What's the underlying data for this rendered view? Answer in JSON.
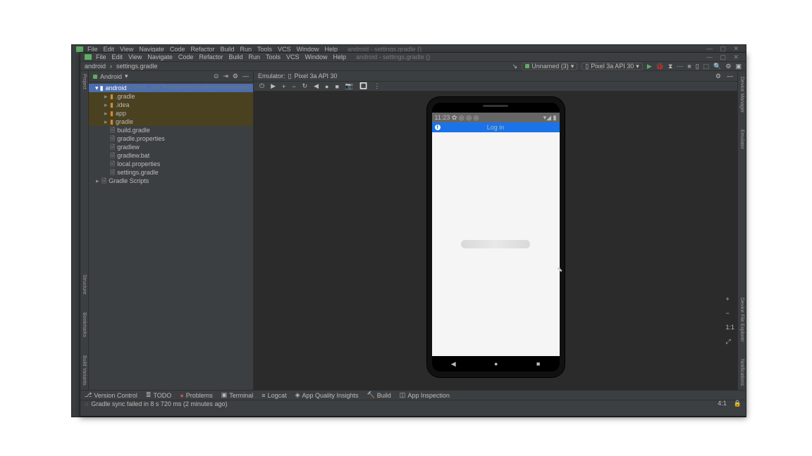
{
  "window_outer": {
    "title_hint": "android - settings.gradle ()",
    "menu": [
      "File",
      "Edit",
      "View",
      "Navigate",
      "Code",
      "Refactor",
      "Build",
      "Run",
      "Tools",
      "VCS",
      "Window",
      "Help"
    ]
  },
  "window_inner": {
    "menu": [
      "File",
      "Edit",
      "View",
      "Navigate",
      "Code",
      "Refactor",
      "Build",
      "Run",
      "Tools",
      "VCS",
      "Window",
      "Help"
    ],
    "tab_hint": "android - settings.gradle ()"
  },
  "breadcrumb": {
    "root": "android",
    "file": "settings.gradle"
  },
  "toolbar": {
    "run_config": "Unnamed (3)",
    "device": "Pixel 3a API 30"
  },
  "left_gutter": [
    "Project"
  ],
  "right_gutter_outer": [
    "Device Manager",
    "Emulator"
  ],
  "right_gutter_inner": [
    "Device File Explorer",
    "Notifications"
  ],
  "project_pane": {
    "header": "Android",
    "tree": [
      {
        "d": 0,
        "expand": "▾",
        "icon": "folder",
        "label": "android",
        "path": "C:\\Users\\...Day Tech\\appsinfoo\\sandbox\\android\\android",
        "sel": true
      },
      {
        "d": 1,
        "expand": "▸",
        "icon": "folder",
        "label": ".gradle",
        "hl": true
      },
      {
        "d": 1,
        "expand": "▸",
        "icon": "folder",
        "label": ".idea",
        "hl": true
      },
      {
        "d": 1,
        "expand": "▸",
        "icon": "folder",
        "label": "app",
        "hl": true
      },
      {
        "d": 1,
        "expand": "▸",
        "icon": "folder",
        "label": "gradle",
        "hl": true
      },
      {
        "d": 1,
        "expand": "",
        "icon": "file",
        "label": "build.gradle"
      },
      {
        "d": 1,
        "expand": "",
        "icon": "file",
        "label": "gradle.properties"
      },
      {
        "d": 1,
        "expand": "",
        "icon": "file",
        "label": "gradlew"
      },
      {
        "d": 1,
        "expand": "",
        "icon": "file",
        "label": "gradlew.bat"
      },
      {
        "d": 1,
        "expand": "",
        "icon": "file",
        "label": "local.properties"
      },
      {
        "d": 1,
        "expand": "",
        "icon": "file",
        "label": "settings.gradle"
      },
      {
        "d": 0,
        "expand": "▸",
        "icon": "file",
        "label": "Gradle Scripts"
      }
    ]
  },
  "editor_tabs": {
    "left": "Emulator:",
    "device": "Pixel 3a API 30"
  },
  "emu_toolbar_icons": [
    "⏻",
    "▶",
    "+",
    "−",
    "↻",
    "◀",
    "●",
    "■",
    "📷",
    "🔳",
    "⋮"
  ],
  "phone": {
    "status_time": "11:23",
    "status_icons_left": "✿ ◎ ◎ ◎",
    "status_icons_right": "▾◢ ▮",
    "appbar_label": "Log in",
    "nav": [
      "◀",
      "●",
      "■"
    ]
  },
  "right_tool_icons": [
    "+",
    "−",
    "1:1",
    "⤢"
  ],
  "bottom_panel": [
    {
      "icon": "⎇",
      "label": "Version Control"
    },
    {
      "icon": "≣",
      "label": "TODO"
    },
    {
      "icon": "●",
      "label": "Problems",
      "red": true
    },
    {
      "icon": "▣",
      "label": "Terminal"
    },
    {
      "icon": "≡",
      "label": "Logcat"
    },
    {
      "icon": "◈",
      "label": "App Quality Insights"
    },
    {
      "icon": "🔨",
      "label": "Build"
    },
    {
      "icon": "◫",
      "label": "App Inspection"
    }
  ],
  "status": {
    "msg": "Gradle sync failed in 8 s 720 ms (2 minutes ago)",
    "pos": "4:1"
  }
}
